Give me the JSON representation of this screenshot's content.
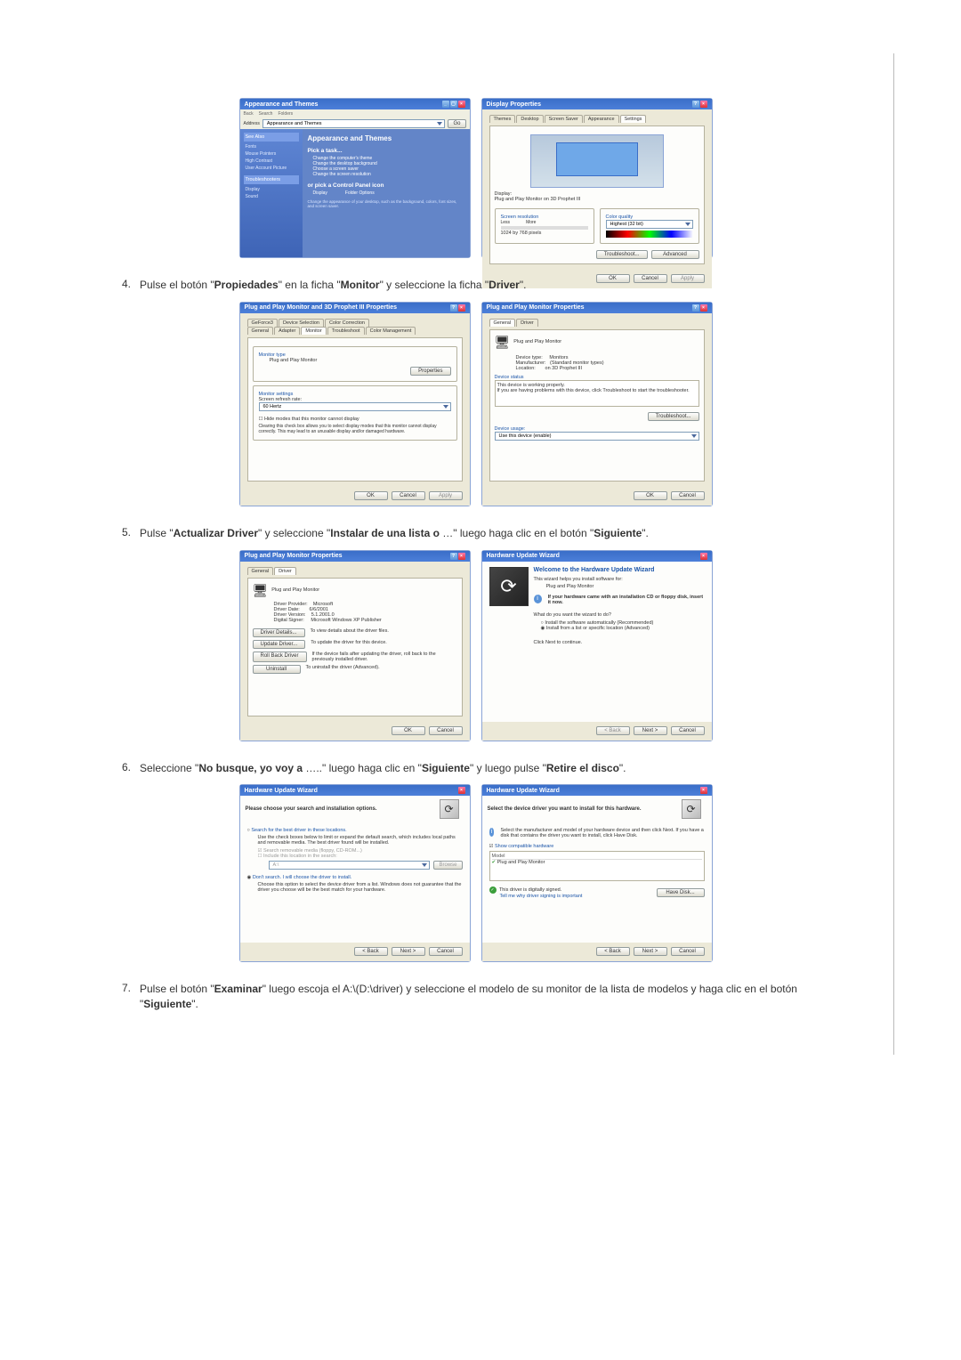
{
  "steps": {
    "s4": {
      "num": "4.",
      "pre": "Pulse el botón \"",
      "b1": "Propiedades",
      "mid1": "\" en la ficha \"",
      "b2": "Monitor",
      "mid2": "\" y seleccione la ficha \"",
      "b3": "Driver",
      "post": "\"."
    },
    "s5": {
      "num": "5.",
      "pre": "Pulse \"",
      "b1": "Actualizar Driver",
      "mid1": "\" y seleccione \"",
      "b2": "Instalar de una lista o",
      "mid2": " …\" luego haga clic en el botón \"",
      "b3": "Siguiente",
      "post": "\"."
    },
    "s6": {
      "num": "6.",
      "pre": "Seleccione \"",
      "b1": "No busque, yo voy a",
      "mid1": " …..\" luego haga clic en \"",
      "b2": "Siguiente",
      "mid2": "\" y luego pulse \"",
      "b3": "Retire el disco",
      "post": "\"."
    },
    "s7": {
      "num": "7.",
      "pre": "Pulse el botón \"",
      "b1": "Examinar",
      "mid1": "\" luego escoja el A:\\(D:\\driver) y seleccione el modelo de su monitor de la lista de modelos y haga clic en el botón \"",
      "b2": "Siguiente",
      "post": "\"."
    }
  },
  "common_btns": {
    "ok": "OK",
    "cancel": "Cancel",
    "apply": "Apply",
    "back": "< Back",
    "next": "Next >",
    "browse": "Browse",
    "have_disk": "Have Disk..."
  },
  "panelA1": {
    "title": "Appearance and Themes",
    "toolbar": {
      "back": "Back",
      "fwd": " ",
      "search": "Search",
      "folders": "Folders"
    },
    "address_label": "Address",
    "address_value": "Appearance and Themes",
    "sidebar": {
      "seealso_head": "See Also",
      "seealso": [
        "Fonts",
        "Mouse Pointers",
        "High Contrast",
        "User Account Picture"
      ],
      "trouble_head": "Troubleshooters",
      "trouble": [
        "Display",
        "Sound"
      ]
    },
    "main": {
      "heading": "Appearance and Themes",
      "pick": "Pick a task...",
      "tasks": [
        "Change the computer's theme",
        "Change the desktop background",
        "Choose a screen saver",
        "Change the screen resolution"
      ],
      "cp_heading": "or pick a Control Panel icon",
      "icons": [
        "Display",
        "Folder Options"
      ],
      "footer": "Change the appearance of your desktop, such as the background, colors, font sizes, and screen saver."
    }
  },
  "panelA2": {
    "title": "Display Properties",
    "tabs": [
      "Themes",
      "Desktop",
      "Screen Saver",
      "Appearance",
      "Settings"
    ],
    "display_label": "Display:",
    "display_value": "Plug and Play Monitor on 3D Prophet III",
    "screenres_label": "Screen resolution",
    "less": "Less",
    "more": "More",
    "res_value": "1024 by 768 pixels",
    "colorq_label": "Color quality",
    "colorq_value": "Highest (32 bit)",
    "troubleshoot": "Troubleshoot...",
    "advanced": "Advanced"
  },
  "panelB1": {
    "title": "Plug and Play Monitor and 3D Prophet III Properties",
    "tabs_top": [
      "GeForce3",
      "Device Selection",
      "Color Correction"
    ],
    "tabs_bot": [
      "General",
      "Adapter",
      "Monitor",
      "Troubleshoot",
      "Color Management"
    ],
    "monitor_type": "Monitor type",
    "monitor_name": "Plug and Play Monitor",
    "properties": "Properties",
    "monitor_settings": "Monitor settings",
    "refresh_label": "Screen refresh rate:",
    "refresh_val": "60 Hertz",
    "hide_check": "Hide modes that this monitor cannot display",
    "hide_desc": "Clearing this check box allows you to select display modes that this monitor cannot display correctly. This may lead to an unusable display and/or damaged hardware."
  },
  "panelB2": {
    "title": "Plug and Play Monitor Properties",
    "tabs": [
      "General",
      "Driver"
    ],
    "heading": "Plug and Play Monitor",
    "devtype_lbl": "Device type:",
    "devtype_val": "Monitors",
    "manu_lbl": "Manufacturer:",
    "manu_val": "(Standard monitor types)",
    "loc_lbl": "Location:",
    "loc_val": "on 3D Prophet III",
    "status_head": "Device status",
    "status_body1": "This device is working properly.",
    "status_body2": "If you are having problems with this device, click Troubleshoot to start the troubleshooter.",
    "troubleshoot": "Troubleshoot...",
    "usage_lbl": "Device usage:",
    "usage_val": "Use this device (enable)"
  },
  "panelC1": {
    "title": "Plug and Play Monitor Properties",
    "tabs": [
      "General",
      "Driver"
    ],
    "heading": "Plug and Play Monitor",
    "rows": {
      "prov_lbl": "Driver Provider:",
      "prov_val": "Microsoft",
      "date_lbl": "Driver Date:",
      "date_val": "6/6/2001",
      "ver_lbl": "Driver Version:",
      "ver_val": "5.1.2001.0",
      "sig_lbl": "Digital Signer:",
      "sig_val": "Microsoft Windows XP Publisher"
    },
    "details_btn": "Driver Details...",
    "details_desc": "To view details about the driver files.",
    "update_btn": "Update Driver...",
    "update_desc": "To update the driver for this device.",
    "rollback_btn": "Roll Back Driver",
    "rollback_desc": "If the device fails after updating the driver, roll back to the previously installed driver.",
    "uninstall_btn": "Uninstall",
    "uninstall_desc": "To uninstall the driver (Advanced)."
  },
  "panelC2": {
    "title": "Hardware Update Wizard",
    "welcome": "Welcome to the Hardware Update Wizard",
    "intro1": "This wizard helps you install software for:",
    "intro_device": "Plug and Play Monitor",
    "cdprompt": "If your hardware came with an installation CD or floppy disk, insert it now.",
    "q": "What do you want the wizard to do?",
    "opt1": "Install the software automatically (Recommended)",
    "opt2": "Install from a list or specific location (Advanced)",
    "continue": "Click Next to continue."
  },
  "panelD1": {
    "title": "Hardware Update Wizard",
    "heading": "Please choose your search and installation options.",
    "opt_search": "Search for the best driver in these locations.",
    "search_desc": "Use the check boxes below to limit or expand the default search, which includes local paths and removable media. The best driver found will be installed.",
    "chk1": "Search removable media (floppy, CD-ROM...)",
    "chk2": "Include this location in the search:",
    "path": "A:\\",
    "opt_dont": "Don't search. I will choose the driver to install.",
    "dont_desc": "Choose this option to select the device driver from a list. Windows does not guarantee that the driver you choose will be the best match for your hardware."
  },
  "panelD2": {
    "title": "Hardware Update Wizard",
    "heading": "Select the device driver you want to install for this hardware.",
    "instr": "Select the manufacturer and model of your hardware device and then click Next. If you have a disk that contains the driver you want to install, click Have Disk.",
    "compat_chk": "Show compatible hardware",
    "model_lbl": "Model",
    "model_item": "Plug and Play Monitor",
    "signed_txt": "This driver is digitally signed.",
    "signed_link": "Tell me why driver signing is important"
  }
}
